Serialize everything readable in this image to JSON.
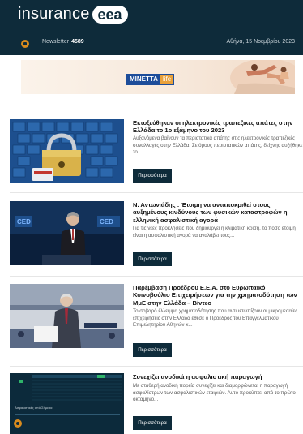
{
  "header": {
    "logo_word": "insurance",
    "logo_pill": "eea",
    "newsletter_label": "Newsletter",
    "newsletter_number": "4589",
    "date": "Αθήνα, 15 Νοεμβρίου 2023"
  },
  "ad": {
    "brand_primary": "MINETTA",
    "brand_secondary": "life"
  },
  "articles": [
    {
      "title": "Εκτοξεύθηκαν οι ηλεκτρονικές τραπεζικές απάτες στην Ελλάδα το 1ο εξάμηνο του 2023",
      "description": "Αυξανόμενα βαίνουν τα περιστατικά απάτης στις ηλεκτρονικές τραπεζικές συναλλαγές στην Ελλάδα. Σε όρους περιστατικών απάτης, δείχνης αυξήθηκε το...",
      "button": "Περισσότερα",
      "image": "laptop-padlock-keyboard-image"
    },
    {
      "title": "Ν. Αντωνιάδης : Έτοιμη να ανταποκριθεί στους αυξημένους κινδύνους των φυσικών καταστροφών η ελληνική ασφαλιστική αγορά",
      "description": "Για τις νέες προκλήσεις που δημιουργεί η κλιματική κρίση, το πόσο έτοιμη είναι η ασφαλιστική αγορά να αναλάβει τους...",
      "button": "Περισσότερα",
      "image": "speaker-on-stage-image"
    },
    {
      "title": "Παρέμβαση Προέδρου Ε.Ε.Α. στο Ευρωπαϊκό Κοινοβούλιο Επιχειρήσεων για την χρηματοδότηση των ΜμΕ στην Ελλάδα – Βίντεο",
      "description": "Το σοβαρό έλλειμμα χρηματοδότησης που αντιμετωπίζουν οι μικρομεσαίες επιχειρήσεις στην Ελλάδα έθεσε ο Πρόεδρος του Επαγγελματικού Επιμελητηρίου Αθηνών κ...",
      "button": "Περισσότερα",
      "image": "speaker-at-parliament-image"
    },
    {
      "title": "Συνεχίζει ανοδικά η ασφαλιστική παραγωγή",
      "description": "Με σταθερή ανοδική πορεία συνεχίζει και διαμορφώνεται η παραγωγή ασφαλίστρων των ασφαλιστικών εταιριών. Αυτό προκύπτει από το πρώτο οκτάμηνο...",
      "button": "Περισσότερα",
      "image": "insurance-production-report-image",
      "image_caption": "Ασφαλιστικές από Σήμερα"
    }
  ],
  "colors": {
    "header_bg": "#0e2b3a",
    "button_bg": "#0e2b3a",
    "accent_orange": "#d98b1e"
  }
}
